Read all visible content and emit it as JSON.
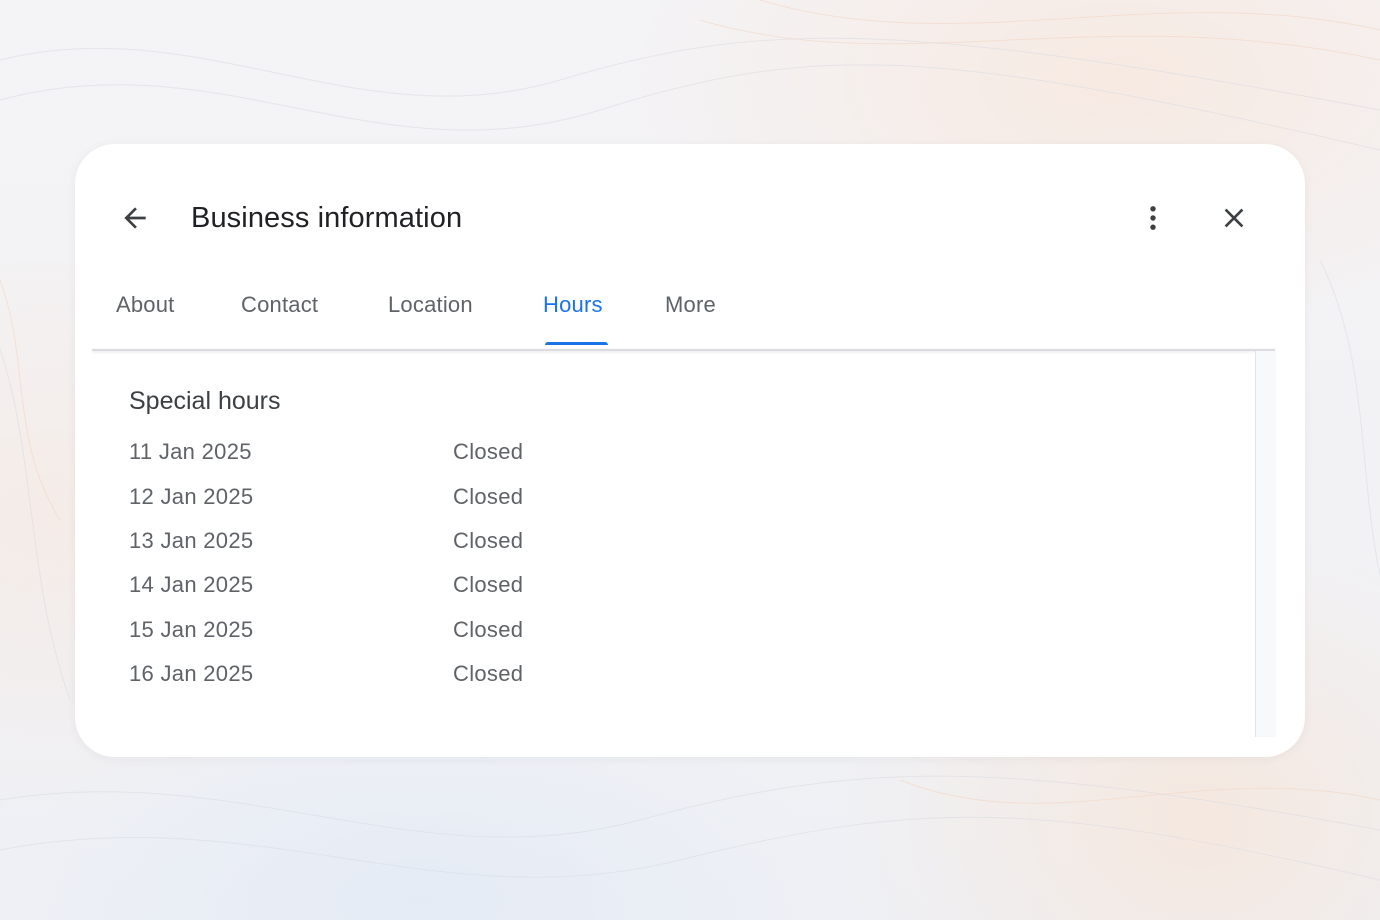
{
  "dialog": {
    "title": "Business information"
  },
  "tabs": [
    {
      "label": "About",
      "active": false
    },
    {
      "label": "Contact",
      "active": false
    },
    {
      "label": "Location",
      "active": false
    },
    {
      "label": "Hours",
      "active": true
    },
    {
      "label": "More",
      "active": false
    }
  ],
  "special_hours": {
    "heading": "Special hours",
    "rows": [
      {
        "date": "11 Jan 2025",
        "status": "Closed"
      },
      {
        "date": "12 Jan 2025",
        "status": "Closed"
      },
      {
        "date": "13 Jan 2025",
        "status": "Closed"
      },
      {
        "date": "14 Jan 2025",
        "status": "Closed"
      },
      {
        "date": "15 Jan 2025",
        "status": "Closed"
      },
      {
        "date": "16 Jan 2025",
        "status": "Closed"
      }
    ]
  },
  "icons": {
    "back": "arrow-back-icon",
    "more": "more-vert-icon",
    "close": "close-icon"
  },
  "colors": {
    "accent": "#1a73e8",
    "title_text": "#202124",
    "secondary_text": "#5f6368"
  }
}
